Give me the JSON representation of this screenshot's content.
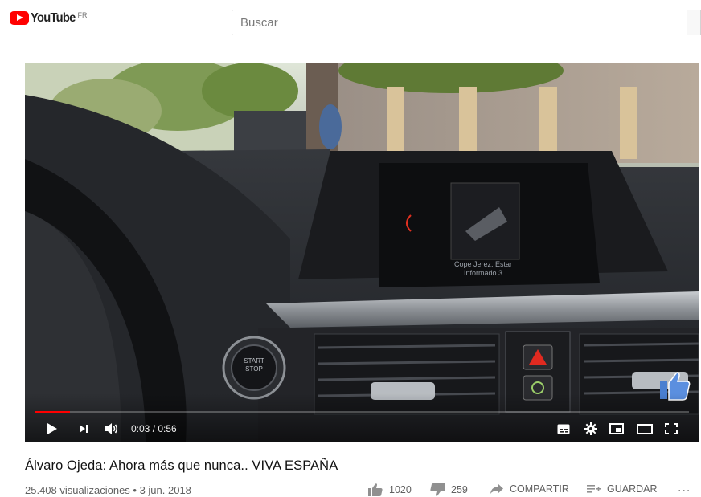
{
  "header": {
    "logo_text": "YouTube",
    "country_code": "FR",
    "search_placeholder": "Buscar"
  },
  "player": {
    "current_time": "0:03",
    "duration": "0:56",
    "time_display": "0:03 / 0:56",
    "played_fraction": 0.054,
    "buffered_fraction": 0.054,
    "accent_color": "#ff0000"
  },
  "video": {
    "title": "Álvaro Ojeda: Ahora más que nunca.. VIVA ESPAÑA",
    "views_date": "25.408 visualizaciones • 3 jun. 2018",
    "likes": "1020",
    "dislikes": "259",
    "share_label": "COMPARTIR",
    "save_label": "GUARDAR",
    "more_label": "..."
  },
  "icons": [
    "youtube-logo-icon",
    "play-icon",
    "next-icon",
    "volume-icon",
    "subtitles-icon",
    "settings-icon",
    "miniplayer-icon",
    "theater-icon",
    "fullscreen-icon",
    "like-icon",
    "dislike-icon",
    "share-icon",
    "save-playlist-icon",
    "thumbs-up-watermark-icon"
  ],
  "frame": {
    "radio_text_1": "Cope Jerez. Estar",
    "radio_text_2": "Informado 3",
    "start_stop_1": "START",
    "start_stop_2": "STOP"
  }
}
